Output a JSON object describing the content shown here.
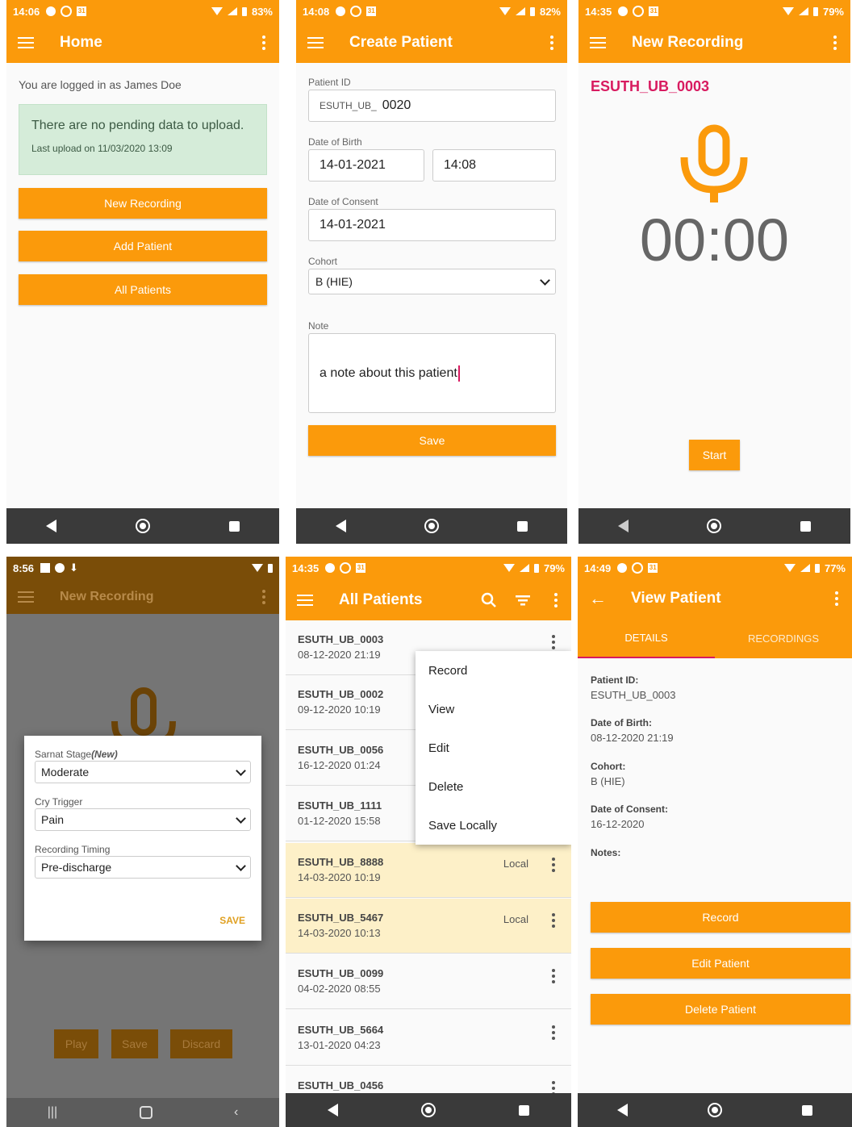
{
  "screen_home": {
    "status": {
      "time": "14:06",
      "battery": "83%"
    },
    "title": "Home",
    "logged_in": "You are logged in as James Doe",
    "notice_title": "There are no pending data to upload.",
    "notice_sub": "Last upload on 11/03/2020 13:09",
    "buttons": [
      "New Recording",
      "Add Patient",
      "All Patients"
    ]
  },
  "screen_create": {
    "status": {
      "time": "14:08",
      "battery": "82%"
    },
    "title": "Create Patient",
    "patient_id_label": "Patient ID",
    "patient_id_prefix": "ESUTH_UB_",
    "patient_id_value": "0020",
    "dob_label": "Date of Birth",
    "dob_date": "14-01-2021",
    "dob_time": "14:08",
    "consent_label": "Date of Consent",
    "consent_date": "14-01-2021",
    "cohort_label": "Cohort",
    "cohort_value": "B (HIE)",
    "note_label": "Note",
    "note_value": "a note about this patient",
    "save": "Save"
  },
  "screen_recording": {
    "status": {
      "time": "14:35",
      "battery": "79%"
    },
    "title": "New Recording",
    "patient_id": "ESUTH_UB_0003",
    "timer": "00:00",
    "start": "Start"
  },
  "screen_dialog": {
    "status": {
      "time": "8:56"
    },
    "title": "New Recording",
    "sarnat_label": "Sarnat Stage",
    "sarnat_new": "(New)",
    "sarnat_value": "Moderate",
    "cry_label": "Cry Trigger",
    "cry_value": "Pain",
    "timing_label": "Recording Timing",
    "timing_value": "Pre-discharge",
    "save": "SAVE",
    "bg_buttons": [
      "Play",
      "Save",
      "Discard"
    ]
  },
  "screen_patients": {
    "status": {
      "time": "14:35",
      "battery": "79%"
    },
    "title": "All Patients",
    "rows": [
      {
        "id": "ESUTH_UB_0003",
        "date": "08-12-2020 21:19",
        "local": ""
      },
      {
        "id": "ESUTH_UB_0002",
        "date": "09-12-2020 10:19",
        "local": ""
      },
      {
        "id": "ESUTH_UB_0056",
        "date": "16-12-2020 01:24",
        "local": ""
      },
      {
        "id": "ESUTH_UB_1111",
        "date": "01-12-2020 15:58",
        "local": ""
      },
      {
        "id": "ESUTH_UB_8888",
        "date": "14-03-2020 10:19",
        "local": "Local"
      },
      {
        "id": "ESUTH_UB_5467",
        "date": "14-03-2020 10:13",
        "local": "Local"
      },
      {
        "id": "ESUTH_UB_0099",
        "date": "04-02-2020 08:55",
        "local": ""
      },
      {
        "id": "ESUTH_UB_5664",
        "date": "13-01-2020 04:23",
        "local": ""
      },
      {
        "id": "ESUTH_UB_0456",
        "date": "",
        "local": ""
      }
    ],
    "menu": [
      "Record",
      "View",
      "Edit",
      "Delete",
      "Save Locally"
    ]
  },
  "screen_view": {
    "status": {
      "time": "14:49",
      "battery": "77%"
    },
    "title": "View Patient",
    "tabs": [
      "DETAILS",
      "RECORDINGS"
    ],
    "fields": [
      {
        "label": "Patient ID:",
        "value": "ESUTH_UB_0003"
      },
      {
        "label": "Date of Birth:",
        "value": "08-12-2020 21:19"
      },
      {
        "label": "Cohort:",
        "value": "B (HIE)"
      },
      {
        "label": "Date of Consent:",
        "value": "16-12-2020"
      },
      {
        "label": "Notes:",
        "value": ""
      }
    ],
    "buttons": [
      "Record",
      "Edit Patient",
      "Delete Patient"
    ]
  },
  "colors": {
    "accent": "#fb9a0b",
    "pink": "#d81b60",
    "local_row": "#fdf0c8",
    "notice_bg": "#d5ecd9"
  }
}
